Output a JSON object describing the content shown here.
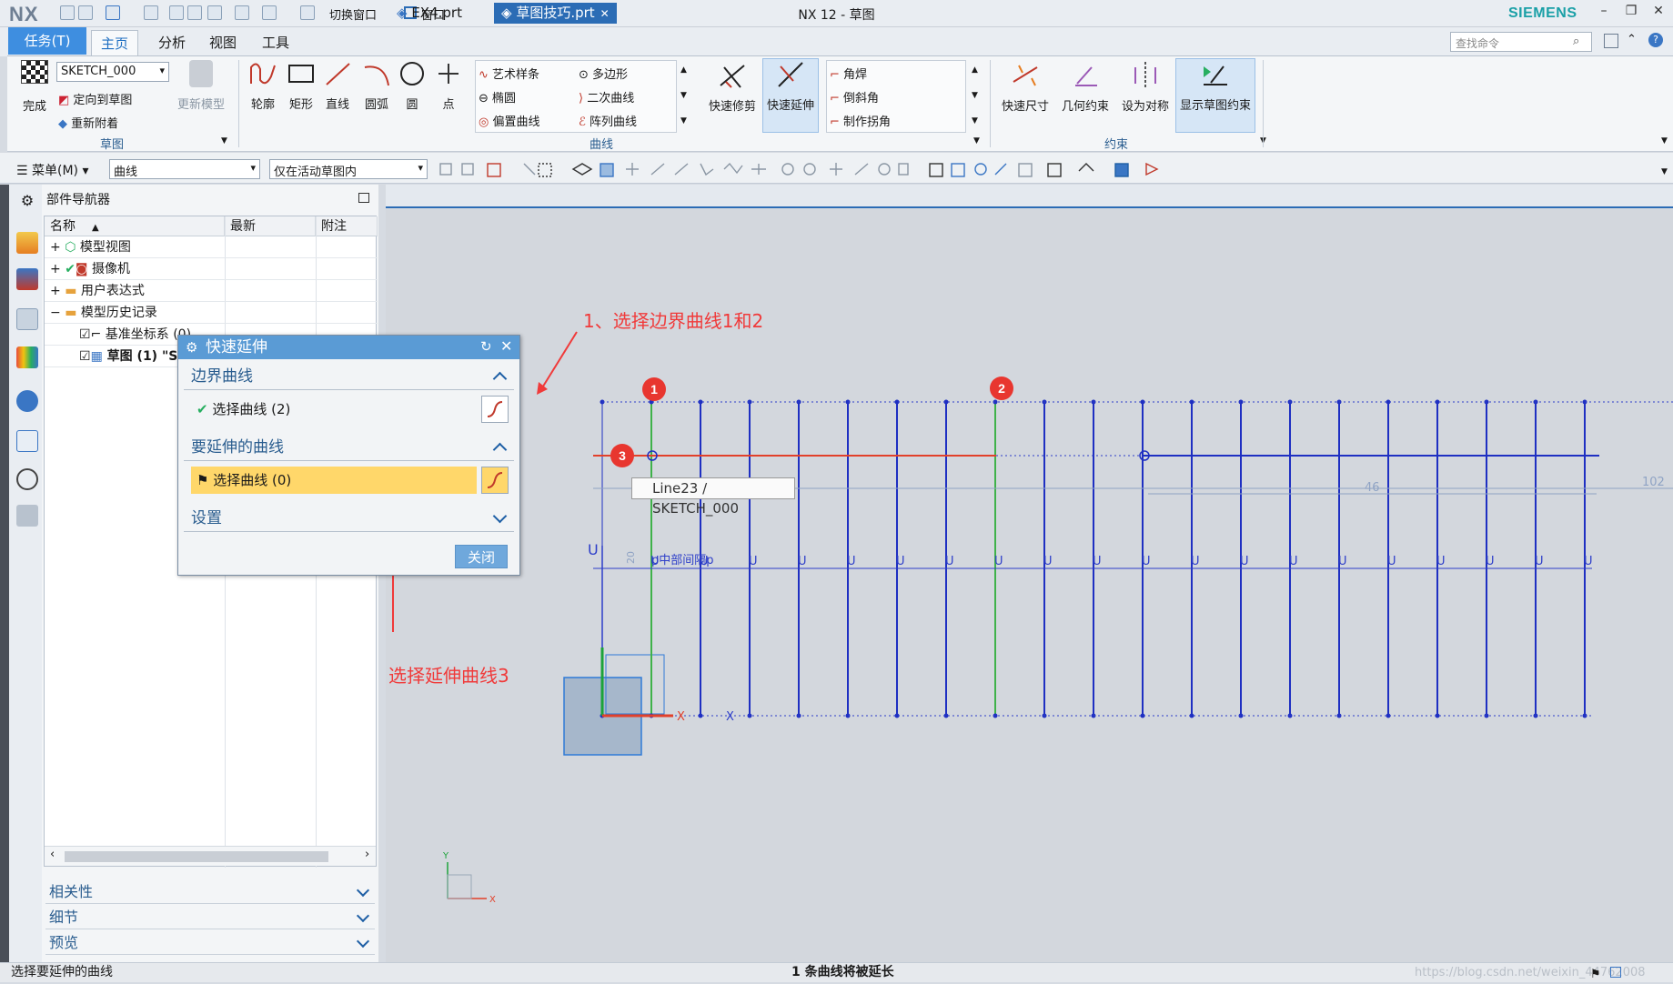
{
  "titlebar": {
    "logo": "NX",
    "title": "NX 12 - 草图",
    "brand": "SIEMENS",
    "quick": {
      "switch_window": "切换窗口",
      "window": "窗口"
    }
  },
  "tabs": {
    "task": "任务(T)",
    "items": [
      "主页",
      "分析",
      "视图",
      "工具"
    ],
    "active": "主页",
    "search_placeholder": "查找命令"
  },
  "ribbon": {
    "finish": "完成",
    "sketch_combo": "SKETCH_000",
    "orient": "定向到草图",
    "reattach": "重新附着",
    "update_model": "更新模型",
    "group_sketch": "草图",
    "profile": "轮廓",
    "rect": "矩形",
    "line": "直线",
    "arc": "圆弧",
    "circle": "圆",
    "point": "点",
    "art_spline": "艺术样条",
    "polygon": "多边形",
    "ellipse": "椭圆",
    "conic": "二次曲线",
    "offset_curve": "偏置曲线",
    "pattern_curve": "阵列曲线",
    "group_curve": "曲线",
    "quick_trim": "快速修剪",
    "quick_extend": "快速延伸",
    "fillet": "角焊",
    "chamfer": "倒斜角",
    "make_corner": "制作拐角",
    "rapid_dim": "快速尺寸",
    "geom_constraint": "几何约束",
    "make_symmetric": "设为对称",
    "show_constraints": "显示草图约束",
    "group_constraint": "约束"
  },
  "toolbar": {
    "menu": "菜单(M)",
    "filter": "曲线",
    "scope": "仅在活动草图内"
  },
  "navigator": {
    "title": "部件导航器",
    "cols": [
      "名称",
      "最新",
      "附注"
    ],
    "rows": [
      "模型视图",
      "摄像机",
      "用户表达式",
      "模型历史记录",
      "基准坐标系 (0)",
      "草图 (1) \"S"
    ],
    "sections": [
      "相关性",
      "细节",
      "预览"
    ]
  },
  "doc_tabs": [
    "EX4.prt",
    "草图技巧.prt"
  ],
  "dialog": {
    "title": "快速延伸",
    "sec_boundary": "边界曲线",
    "boundary_select": "选择曲线 (2)",
    "sec_extend": "要延伸的曲线",
    "extend_select": "选择曲线 (0)",
    "sec_settings": "设置",
    "close": "关闭"
  },
  "annotations": {
    "a1": "1、选择边界曲线1和2",
    "a2": "选择延伸曲线3",
    "m1": "1",
    "m2": "2",
    "m3": "3"
  },
  "tooltip": "Line23 / SKETCH_000",
  "dims": {
    "d102": "102",
    "d46": "46",
    "d_vert": "20",
    "overlap": "p中部间隔p"
  },
  "axis": {
    "x": "X",
    "y": "Y",
    "u": "U"
  },
  "status": {
    "left": "选择要延伸的曲线",
    "center": "1 条曲线将被延长",
    "watermark": "https://blog.csdn.net/weixin_44762008"
  }
}
